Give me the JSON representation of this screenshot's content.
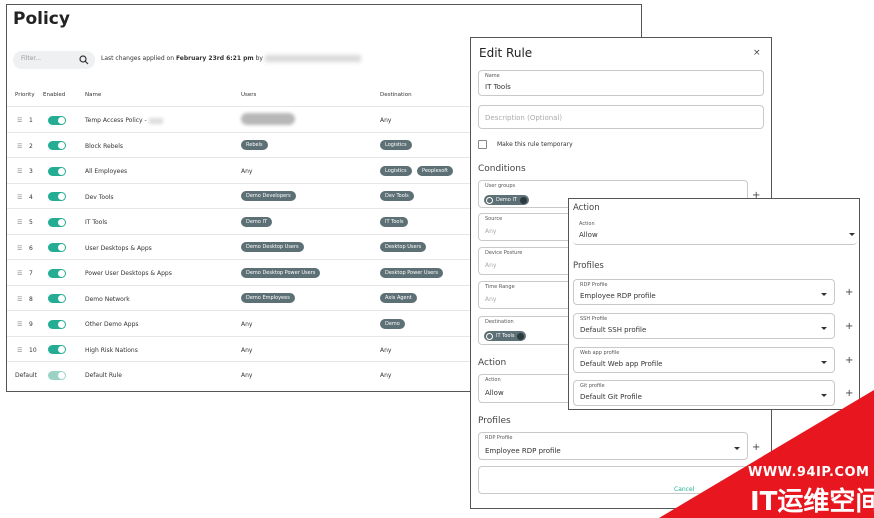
{
  "policy": {
    "title": "Policy",
    "filter_placeholder": "Filter...",
    "last_changes_prefix": "Last changes applied on ",
    "last_changes_date": "February 23rd 6:21 pm",
    "last_changes_by": " by",
    "headers": {
      "priority": "Priority",
      "enabled": "Enabled",
      "name": "Name",
      "users": "Users",
      "destination": "Destination"
    },
    "rows": [
      {
        "priority": "1",
        "name": "Temp Access Policy -",
        "users": "",
        "destination": "Any"
      },
      {
        "priority": "2",
        "name": "Block Rebels",
        "users": "Rebels",
        "destination": "Logistics"
      },
      {
        "priority": "3",
        "name": "All Employees",
        "users": "Any",
        "destination": "Logistics",
        "destination2": "Peoplesoft"
      },
      {
        "priority": "4",
        "name": "Dev Tools",
        "users": "Demo Developers",
        "destination": "Dev Tools"
      },
      {
        "priority": "5",
        "name": "IT Tools",
        "users": "Demo IT",
        "destination": "IT Tools"
      },
      {
        "priority": "6",
        "name": "User Desktops & Apps",
        "users": "Demo Desktop Users",
        "destination": "Desktop Users"
      },
      {
        "priority": "7",
        "name": "Power User Desktops & Apps",
        "users": "Demo Desktop Power Users",
        "destination": "Desktop Power Users"
      },
      {
        "priority": "8",
        "name": "Demo Network",
        "users": "Demo Employees",
        "destination": "Axis Agent"
      },
      {
        "priority": "9",
        "name": "Other Demo Apps",
        "users": "Any",
        "destination": "Demo"
      },
      {
        "priority": "10",
        "name": "High Risk Nations",
        "users": "Any",
        "destination": "Any"
      },
      {
        "priority": "Default",
        "name": "Default Rule",
        "users": "Any",
        "destination": "Any"
      }
    ]
  },
  "edit_rule": {
    "title": "Edit Rule",
    "close": "×",
    "name_label": "Name",
    "name_value": "IT Tools",
    "description_placeholder": "Description (Optional)",
    "temporary_label": "Make this rule temporary",
    "conditions_title": "Conditions",
    "user_groups_label": "User groups",
    "user_groups_chip": "Demo IT",
    "source_label": "Source",
    "source_placeholder": "Any",
    "device_posture_label": "Device Posture",
    "device_posture_placeholder": "Any",
    "time_range_label": "Time Range",
    "time_range_placeholder": "Any",
    "destination_label": "Destination",
    "destination_chip": "IT Tools",
    "action_title": "Action",
    "action_label": "Action",
    "action_value": "Allow",
    "profiles_title": "Profiles",
    "rdp_label": "RDP Profile",
    "rdp_value": "Employee RDP profile",
    "cancel": "Cancel"
  },
  "action_panel": {
    "action_title": "Action",
    "action_label": "Action",
    "action_value": "Allow",
    "profiles_title": "Profiles",
    "rdp_label": "RDP Profile",
    "rdp_value": "Employee RDP profile",
    "ssh_label": "SSH Profile",
    "ssh_value": "Default SSH profile",
    "web_label": "Web app profile",
    "web_value": "Default Web app Profile",
    "git_label": "Git profile",
    "git_value": "Default Git Profile",
    "add": "+"
  },
  "watermark": {
    "url": "WWW.94IP.COM",
    "text": "IT运维空间"
  },
  "colors": {
    "toggle_on": "#25ad93",
    "pill": "#5d7075",
    "watermark": "#e8161e"
  }
}
